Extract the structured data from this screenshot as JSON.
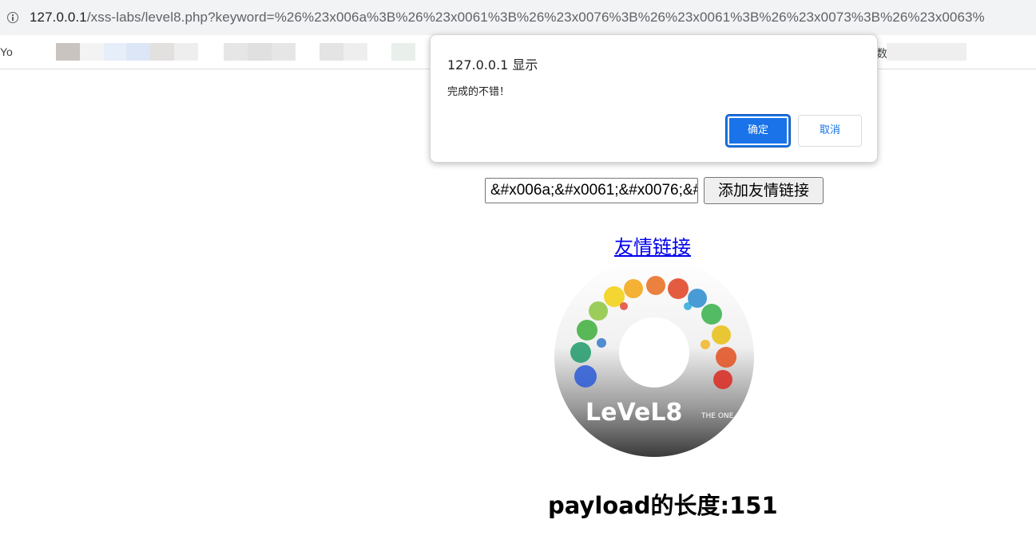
{
  "browser": {
    "url_host": "127.0.0.1",
    "url_rest": "/xss-labs/level8.php?keyword=%26%23x006a%3B%26%23x0061%3B%26%23x0076%3B%26%23x0061%3B%26%23x0073%3B%26%23x0063%",
    "bookmark_first": "Yo",
    "bookmark_last": "数"
  },
  "dialog": {
    "title": "127.0.0.1 显示",
    "message": "完成的不错！",
    "ok_label": "确定",
    "cancel_label": "取消"
  },
  "form": {
    "input_value": "&#x006a;&#x0061;&#x0076;&#x0061;",
    "submit_label": "添加友情链接"
  },
  "link_text": "友情链接",
  "logo_text": "LeVeL8",
  "logo_sub": "THE ONE",
  "payload_text": "payload的长度:151",
  "colors": {
    "dialog_ok": "#1a73e8",
    "link": "#0000ee"
  }
}
